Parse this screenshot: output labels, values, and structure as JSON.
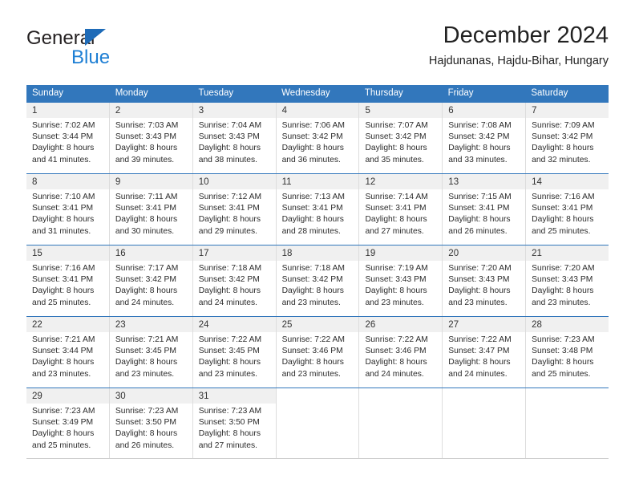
{
  "brand": {
    "word_one": "General",
    "word_two": "Blue",
    "triangle_icon": "blue-triangle-logo-mark",
    "color_dark": "#231f20",
    "color_blue": "#1e7fd4"
  },
  "header": {
    "title": "December 2024",
    "subtitle": "Hajdunanas, Hajdu-Bihar, Hungary"
  },
  "theme": {
    "header_blue": "#3277bc",
    "daynum_band": "#f0f0f0",
    "grid_line": "#dddddd"
  },
  "calendar": {
    "weekdays": [
      "Sunday",
      "Monday",
      "Tuesday",
      "Wednesday",
      "Thursday",
      "Friday",
      "Saturday"
    ],
    "weeks": [
      [
        {
          "day": "1",
          "sunrise": "Sunrise: 7:02 AM",
          "sunset": "Sunset: 3:44 PM",
          "daylight1": "Daylight: 8 hours",
          "daylight2": "and 41 minutes."
        },
        {
          "day": "2",
          "sunrise": "Sunrise: 7:03 AM",
          "sunset": "Sunset: 3:43 PM",
          "daylight1": "Daylight: 8 hours",
          "daylight2": "and 39 minutes."
        },
        {
          "day": "3",
          "sunrise": "Sunrise: 7:04 AM",
          "sunset": "Sunset: 3:43 PM",
          "daylight1": "Daylight: 8 hours",
          "daylight2": "and 38 minutes."
        },
        {
          "day": "4",
          "sunrise": "Sunrise: 7:06 AM",
          "sunset": "Sunset: 3:42 PM",
          "daylight1": "Daylight: 8 hours",
          "daylight2": "and 36 minutes."
        },
        {
          "day": "5",
          "sunrise": "Sunrise: 7:07 AM",
          "sunset": "Sunset: 3:42 PM",
          "daylight1": "Daylight: 8 hours",
          "daylight2": "and 35 minutes."
        },
        {
          "day": "6",
          "sunrise": "Sunrise: 7:08 AM",
          "sunset": "Sunset: 3:42 PM",
          "daylight1": "Daylight: 8 hours",
          "daylight2": "and 33 minutes."
        },
        {
          "day": "7",
          "sunrise": "Sunrise: 7:09 AM",
          "sunset": "Sunset: 3:42 PM",
          "daylight1": "Daylight: 8 hours",
          "daylight2": "and 32 minutes."
        }
      ],
      [
        {
          "day": "8",
          "sunrise": "Sunrise: 7:10 AM",
          "sunset": "Sunset: 3:41 PM",
          "daylight1": "Daylight: 8 hours",
          "daylight2": "and 31 minutes."
        },
        {
          "day": "9",
          "sunrise": "Sunrise: 7:11 AM",
          "sunset": "Sunset: 3:41 PM",
          "daylight1": "Daylight: 8 hours",
          "daylight2": "and 30 minutes."
        },
        {
          "day": "10",
          "sunrise": "Sunrise: 7:12 AM",
          "sunset": "Sunset: 3:41 PM",
          "daylight1": "Daylight: 8 hours",
          "daylight2": "and 29 minutes."
        },
        {
          "day": "11",
          "sunrise": "Sunrise: 7:13 AM",
          "sunset": "Sunset: 3:41 PM",
          "daylight1": "Daylight: 8 hours",
          "daylight2": "and 28 minutes."
        },
        {
          "day": "12",
          "sunrise": "Sunrise: 7:14 AM",
          "sunset": "Sunset: 3:41 PM",
          "daylight1": "Daylight: 8 hours",
          "daylight2": "and 27 minutes."
        },
        {
          "day": "13",
          "sunrise": "Sunrise: 7:15 AM",
          "sunset": "Sunset: 3:41 PM",
          "daylight1": "Daylight: 8 hours",
          "daylight2": "and 26 minutes."
        },
        {
          "day": "14",
          "sunrise": "Sunrise: 7:16 AM",
          "sunset": "Sunset: 3:41 PM",
          "daylight1": "Daylight: 8 hours",
          "daylight2": "and 25 minutes."
        }
      ],
      [
        {
          "day": "15",
          "sunrise": "Sunrise: 7:16 AM",
          "sunset": "Sunset: 3:41 PM",
          "daylight1": "Daylight: 8 hours",
          "daylight2": "and 25 minutes."
        },
        {
          "day": "16",
          "sunrise": "Sunrise: 7:17 AM",
          "sunset": "Sunset: 3:42 PM",
          "daylight1": "Daylight: 8 hours",
          "daylight2": "and 24 minutes."
        },
        {
          "day": "17",
          "sunrise": "Sunrise: 7:18 AM",
          "sunset": "Sunset: 3:42 PM",
          "daylight1": "Daylight: 8 hours",
          "daylight2": "and 24 minutes."
        },
        {
          "day": "18",
          "sunrise": "Sunrise: 7:18 AM",
          "sunset": "Sunset: 3:42 PM",
          "daylight1": "Daylight: 8 hours",
          "daylight2": "and 23 minutes."
        },
        {
          "day": "19",
          "sunrise": "Sunrise: 7:19 AM",
          "sunset": "Sunset: 3:43 PM",
          "daylight1": "Daylight: 8 hours",
          "daylight2": "and 23 minutes."
        },
        {
          "day": "20",
          "sunrise": "Sunrise: 7:20 AM",
          "sunset": "Sunset: 3:43 PM",
          "daylight1": "Daylight: 8 hours",
          "daylight2": "and 23 minutes."
        },
        {
          "day": "21",
          "sunrise": "Sunrise: 7:20 AM",
          "sunset": "Sunset: 3:43 PM",
          "daylight1": "Daylight: 8 hours",
          "daylight2": "and 23 minutes."
        }
      ],
      [
        {
          "day": "22",
          "sunrise": "Sunrise: 7:21 AM",
          "sunset": "Sunset: 3:44 PM",
          "daylight1": "Daylight: 8 hours",
          "daylight2": "and 23 minutes."
        },
        {
          "day": "23",
          "sunrise": "Sunrise: 7:21 AM",
          "sunset": "Sunset: 3:45 PM",
          "daylight1": "Daylight: 8 hours",
          "daylight2": "and 23 minutes."
        },
        {
          "day": "24",
          "sunrise": "Sunrise: 7:22 AM",
          "sunset": "Sunset: 3:45 PM",
          "daylight1": "Daylight: 8 hours",
          "daylight2": "and 23 minutes."
        },
        {
          "day": "25",
          "sunrise": "Sunrise: 7:22 AM",
          "sunset": "Sunset: 3:46 PM",
          "daylight1": "Daylight: 8 hours",
          "daylight2": "and 23 minutes."
        },
        {
          "day": "26",
          "sunrise": "Sunrise: 7:22 AM",
          "sunset": "Sunset: 3:46 PM",
          "daylight1": "Daylight: 8 hours",
          "daylight2": "and 24 minutes."
        },
        {
          "day": "27",
          "sunrise": "Sunrise: 7:22 AM",
          "sunset": "Sunset: 3:47 PM",
          "daylight1": "Daylight: 8 hours",
          "daylight2": "and 24 minutes."
        },
        {
          "day": "28",
          "sunrise": "Sunrise: 7:23 AM",
          "sunset": "Sunset: 3:48 PM",
          "daylight1": "Daylight: 8 hours",
          "daylight2": "and 25 minutes."
        }
      ],
      [
        {
          "day": "29",
          "sunrise": "Sunrise: 7:23 AM",
          "sunset": "Sunset: 3:49 PM",
          "daylight1": "Daylight: 8 hours",
          "daylight2": "and 25 minutes."
        },
        {
          "day": "30",
          "sunrise": "Sunrise: 7:23 AM",
          "sunset": "Sunset: 3:50 PM",
          "daylight1": "Daylight: 8 hours",
          "daylight2": "and 26 minutes."
        },
        {
          "day": "31",
          "sunrise": "Sunrise: 7:23 AM",
          "sunset": "Sunset: 3:50 PM",
          "daylight1": "Daylight: 8 hours",
          "daylight2": "and 27 minutes."
        },
        {
          "day": "",
          "sunrise": "",
          "sunset": "",
          "daylight1": "",
          "daylight2": ""
        },
        {
          "day": "",
          "sunrise": "",
          "sunset": "",
          "daylight1": "",
          "daylight2": ""
        },
        {
          "day": "",
          "sunrise": "",
          "sunset": "",
          "daylight1": "",
          "daylight2": ""
        },
        {
          "day": "",
          "sunrise": "",
          "sunset": "",
          "daylight1": "",
          "daylight2": ""
        }
      ]
    ]
  }
}
